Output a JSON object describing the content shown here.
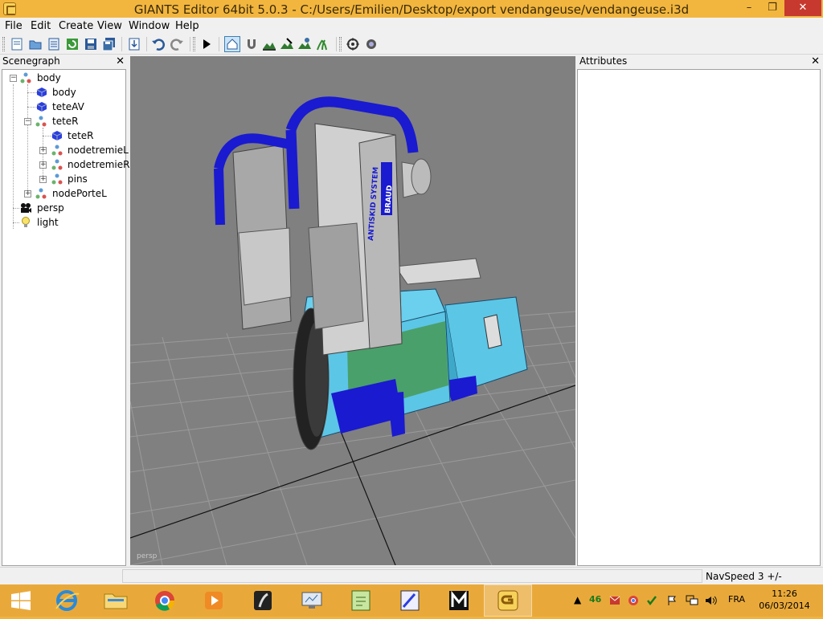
{
  "window": {
    "title": "GIANTS Editor 64bit 5.0.3 - C:/Users/Emilien/Desktop/export vendangeuse/vendangeuse.i3d",
    "minimize": "–",
    "maximize": "❐",
    "close": "✕"
  },
  "menu": [
    {
      "label": "File"
    },
    {
      "label": "Edit"
    },
    {
      "label": "Create"
    },
    {
      "label": "View"
    },
    {
      "label": "Window"
    },
    {
      "label": "Help"
    }
  ],
  "scenegraph": {
    "title": "Scenegraph",
    "close": "✕",
    "nodes": [
      {
        "label": "body",
        "type": "transform"
      },
      {
        "label": "body",
        "type": "shape"
      },
      {
        "label": "teteAV",
        "type": "shape"
      },
      {
        "label": "teteR",
        "type": "transform"
      },
      {
        "label": "teteR",
        "type": "shape"
      },
      {
        "label": "nodetremieL",
        "type": "transform"
      },
      {
        "label": "nodetremieR",
        "type": "transform"
      },
      {
        "label": "pins",
        "type": "transform"
      },
      {
        "label": "nodePorteL",
        "type": "transform"
      },
      {
        "label": "persp",
        "type": "camera"
      },
      {
        "label": "light",
        "type": "light"
      }
    ]
  },
  "attributes": {
    "title": "Attributes",
    "close": "✕"
  },
  "viewport": {
    "camera_label": "persp",
    "model_text": [
      "ANTISKID SYSTEM",
      "BRAUD"
    ]
  },
  "status": {
    "navspeed": "NavSpeed 3 +/-"
  },
  "taskbar": {
    "tray": {
      "counter": "46",
      "language": "FRA"
    },
    "clock": {
      "time": "11:26",
      "date": "06/03/2014"
    }
  },
  "colors": {
    "titlebar": "#f2b63f",
    "taskbar": "#e9a93a",
    "viewport_bg": "#808080",
    "machine_blue": "#5cc6e6",
    "hose_blue": "#1a1ad0"
  }
}
